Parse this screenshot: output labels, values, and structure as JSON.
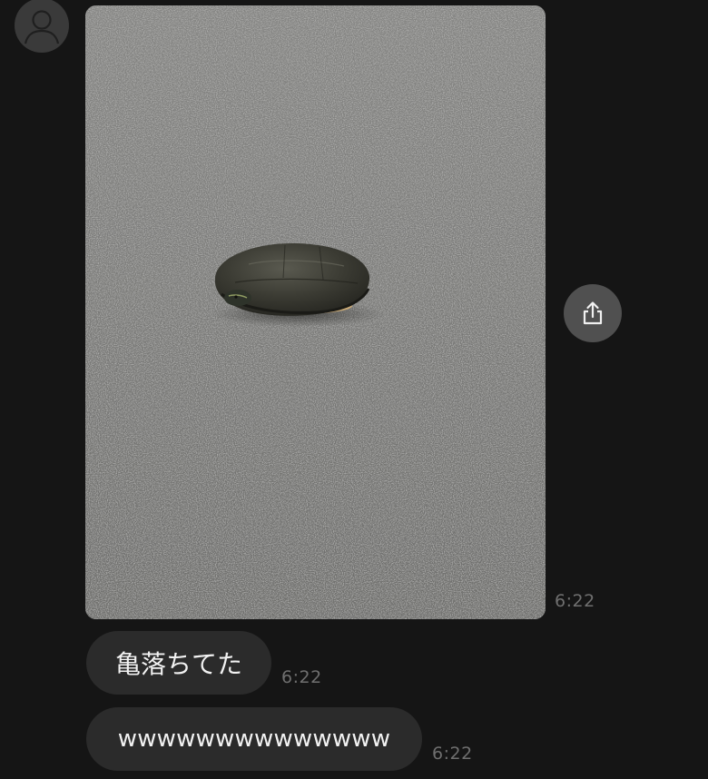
{
  "chat": {
    "sender": {
      "avatar_icon": "person-silhouette-icon"
    },
    "messages": [
      {
        "type": "image",
        "description": "",
        "time": "6:22",
        "share_icon": "share-icon"
      },
      {
        "type": "text",
        "text": "亀落ちてた",
        "time": "6:22"
      },
      {
        "type": "text",
        "text": "wwwwwwwwwwwwww",
        "time": "6:22"
      }
    ]
  },
  "colors": {
    "background": "#151515",
    "bubble": "#2b2b2b",
    "bubble_text": "#f2f2f2",
    "timestamp": "#6f6f6f",
    "share_button": "#505050"
  }
}
